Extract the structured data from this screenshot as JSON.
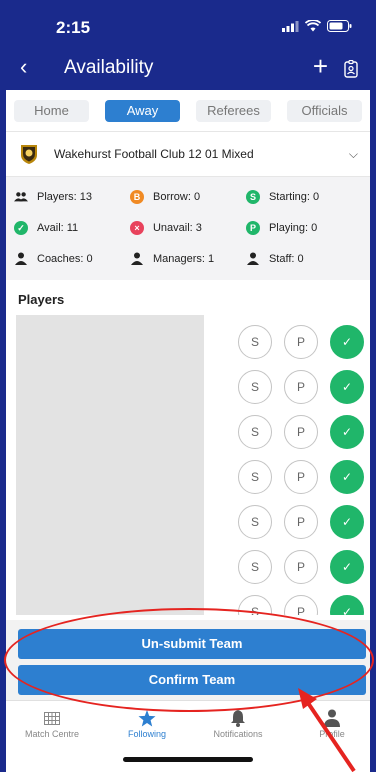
{
  "status_bar": {
    "time": "2:15"
  },
  "nav": {
    "title": "Availability"
  },
  "tabs": [
    {
      "label": "Home",
      "active": false
    },
    {
      "label": "Away",
      "active": true
    },
    {
      "label": "Referees",
      "active": false
    },
    {
      "label": "Officials",
      "active": false
    }
  ],
  "club": {
    "name": "Wakehurst Football Club 12 01 Mixed"
  },
  "stats": {
    "players": "Players: 13",
    "borrow": "Borrow: 0",
    "starting": "Starting: 0",
    "avail": "Avail: 11",
    "unavail": "Unavail: 3",
    "playing": "Playing: 0",
    "coaches": "Coaches: 0",
    "managers": "Managers: 1",
    "staff": "Staff: 0",
    "icons": {
      "borrow": "B",
      "starting": "S",
      "unavail": "×",
      "playing": "P"
    }
  },
  "players_section": {
    "title": "Players"
  },
  "player_rows": [
    {
      "s": "S",
      "p": "P"
    },
    {
      "s": "S",
      "p": "P"
    },
    {
      "s": "S",
      "p": "P"
    },
    {
      "s": "S",
      "p": "P"
    },
    {
      "s": "S",
      "p": "P"
    },
    {
      "s": "S",
      "p": "P"
    },
    {
      "s": "S",
      "p": "P"
    }
  ],
  "actions": {
    "unsubmit": "Un-submit Team",
    "confirm": "Confirm Team"
  },
  "tabbar": [
    {
      "label": "Match Centre",
      "icon": "grid-icon"
    },
    {
      "label": "Following",
      "icon": "star-icon"
    },
    {
      "label": "Notifications",
      "icon": "bell-icon"
    },
    {
      "label": "Profile",
      "icon": "person-icon"
    }
  ],
  "colors": {
    "nav": "#1a2a8c",
    "accent": "#2d7fd0",
    "borrow": "#f08a24",
    "green": "#20b66a",
    "red": "#e8425c",
    "annotation": "#e52420"
  }
}
